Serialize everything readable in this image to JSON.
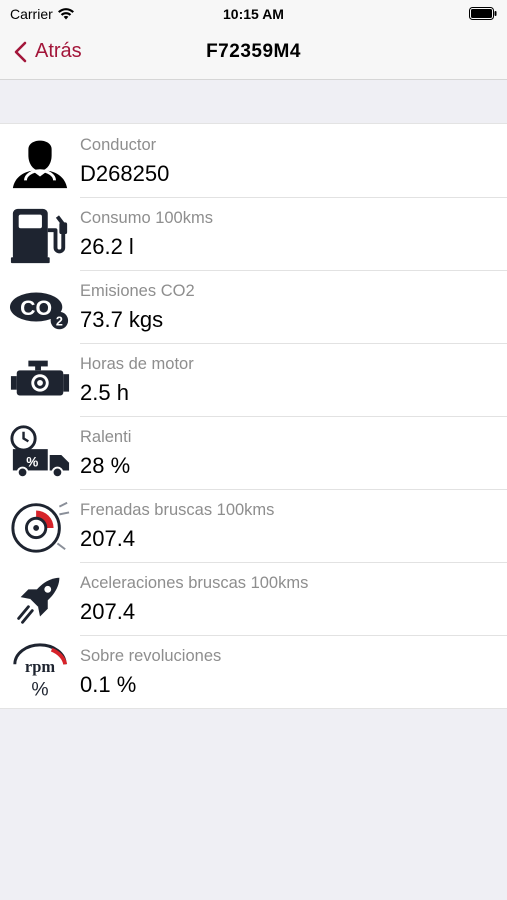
{
  "status_bar": {
    "carrier": "Carrier",
    "time": "10:15 AM"
  },
  "nav": {
    "back_label": "Atrás",
    "title": "F72359M4"
  },
  "colors": {
    "accent": "#a3163a",
    "icon_dark": "#1e2430",
    "brake_red": "#d6232a"
  },
  "metrics": [
    {
      "icon": "driver-icon",
      "label": "Conductor",
      "value": "D268250"
    },
    {
      "icon": "fuel-pump-icon",
      "label": "Consumo 100kms",
      "value": "26.2 l"
    },
    {
      "icon": "co2-icon",
      "label": "Emisiones CO2",
      "value": "73.7 kgs"
    },
    {
      "icon": "engine-icon",
      "label": "Horas de motor",
      "value": "2.5 h"
    },
    {
      "icon": "idle-truck-icon",
      "label": "Ralenti",
      "value": "28 %"
    },
    {
      "icon": "brake-disc-icon",
      "label": "Frenadas bruscas 100kms",
      "value": "207.4"
    },
    {
      "icon": "rocket-icon",
      "label": "Aceleraciones bruscas 100kms",
      "value": "207.4"
    },
    {
      "icon": "rpm-gauge-icon",
      "label": "Sobre revoluciones",
      "value": "0.1 %"
    }
  ],
  "icon_text": {
    "co2": "CO",
    "co2_sub": "2",
    "rpm": "rpm",
    "percent": "%"
  }
}
